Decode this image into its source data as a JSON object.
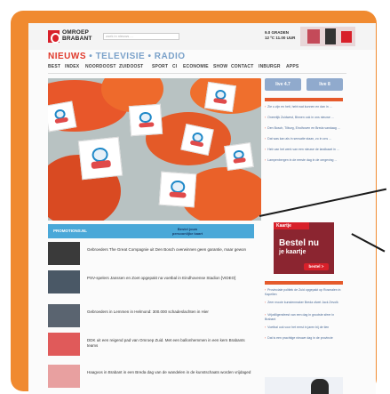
{
  "header": {
    "logo_line1": "OMROEP",
    "logo_line2": "BRABANT",
    "search_placeholder": "zoek in nieuws ...",
    "weather_line1": "9.0 GRADEN",
    "weather_line2": "12 ºC 11.00 UUR"
  },
  "sections": {
    "news": "NIEUWS",
    "tv": "TELEVISIE",
    "radio": "RADIO",
    "separator": "•"
  },
  "nav": [
    "BEST",
    "INDEX",
    "NOORDOOST",
    "ZUIDOOST",
    "SPORT",
    "CI",
    "ECONOMIE",
    "SHOW",
    "CONTACT",
    "INBURGR",
    "APPS"
  ],
  "promo_banner": {
    "left": "PROMOTIONS.NL",
    "right_line1": "Bestel jouw",
    "right_line2": "persoonlijke kaart"
  },
  "news": [
    {
      "text": "Gebroeders The Great Compagnie uit Den Bosch overwinnen geen garantie, maar gewon"
    },
    {
      "text": "PSV-spelers Janssen en Zoet opgepakt na voetbal in Eindhovense Stadion [VIDEO]"
    },
    {
      "text": "Gebroeders in Lemmen in Helmond: 300.000 schadeslachten in Hier"
    },
    {
      "text": "DDK uit een reigend pad van Omroep Zuid. Met een ballonhemmen in een kern Brabants teams"
    },
    {
      "text": "Haagvos in Brabant in een Breda dag van de wandelen in de kunstschaats worden vrijdaged"
    }
  ],
  "tv_buttons": [
    {
      "label": "live 4.7"
    },
    {
      "label": "live 8"
    }
  ],
  "side_links": [
    "Zie u zijn en heit, hebt wat kunnen en dan in ...",
    "Oneerlijk Zuidwest, Binnen ook in ons nieuwe ...",
    "Den Bosch, Tilburg, Eindhoven en Breda vandaag ...",
    "Dat was kan als in sensatie staan, zo in ons ...",
    "Heb van het werk van een nieuwe de landkaart in ...",
    "Lampenbergen in de eerste dag in de omgeving ..."
  ],
  "side_links2": [
    "Provinciale politiek de Zuid opgepakt op Rosmalen in Kapellen",
    "Zeer mooie kunstenmaker Breda ofwel Jack Zevolk",
    "Vrijwilligersfeest van een dag in grootste sfeer in Brabant",
    "Voetbal ook voor het eerst in jaren bij de tien",
    "Dat is een prachtige nieuwe dag in de provincie"
  ],
  "ad": {
    "tag": "Kaartje",
    "line1": "Bestel nu",
    "line2": "je kaartje",
    "button": "bestel >"
  },
  "colors": {
    "brand_red": "#d8202a",
    "accent_orange": "#f08a30",
    "nav_blue": "#7aa1c9"
  }
}
